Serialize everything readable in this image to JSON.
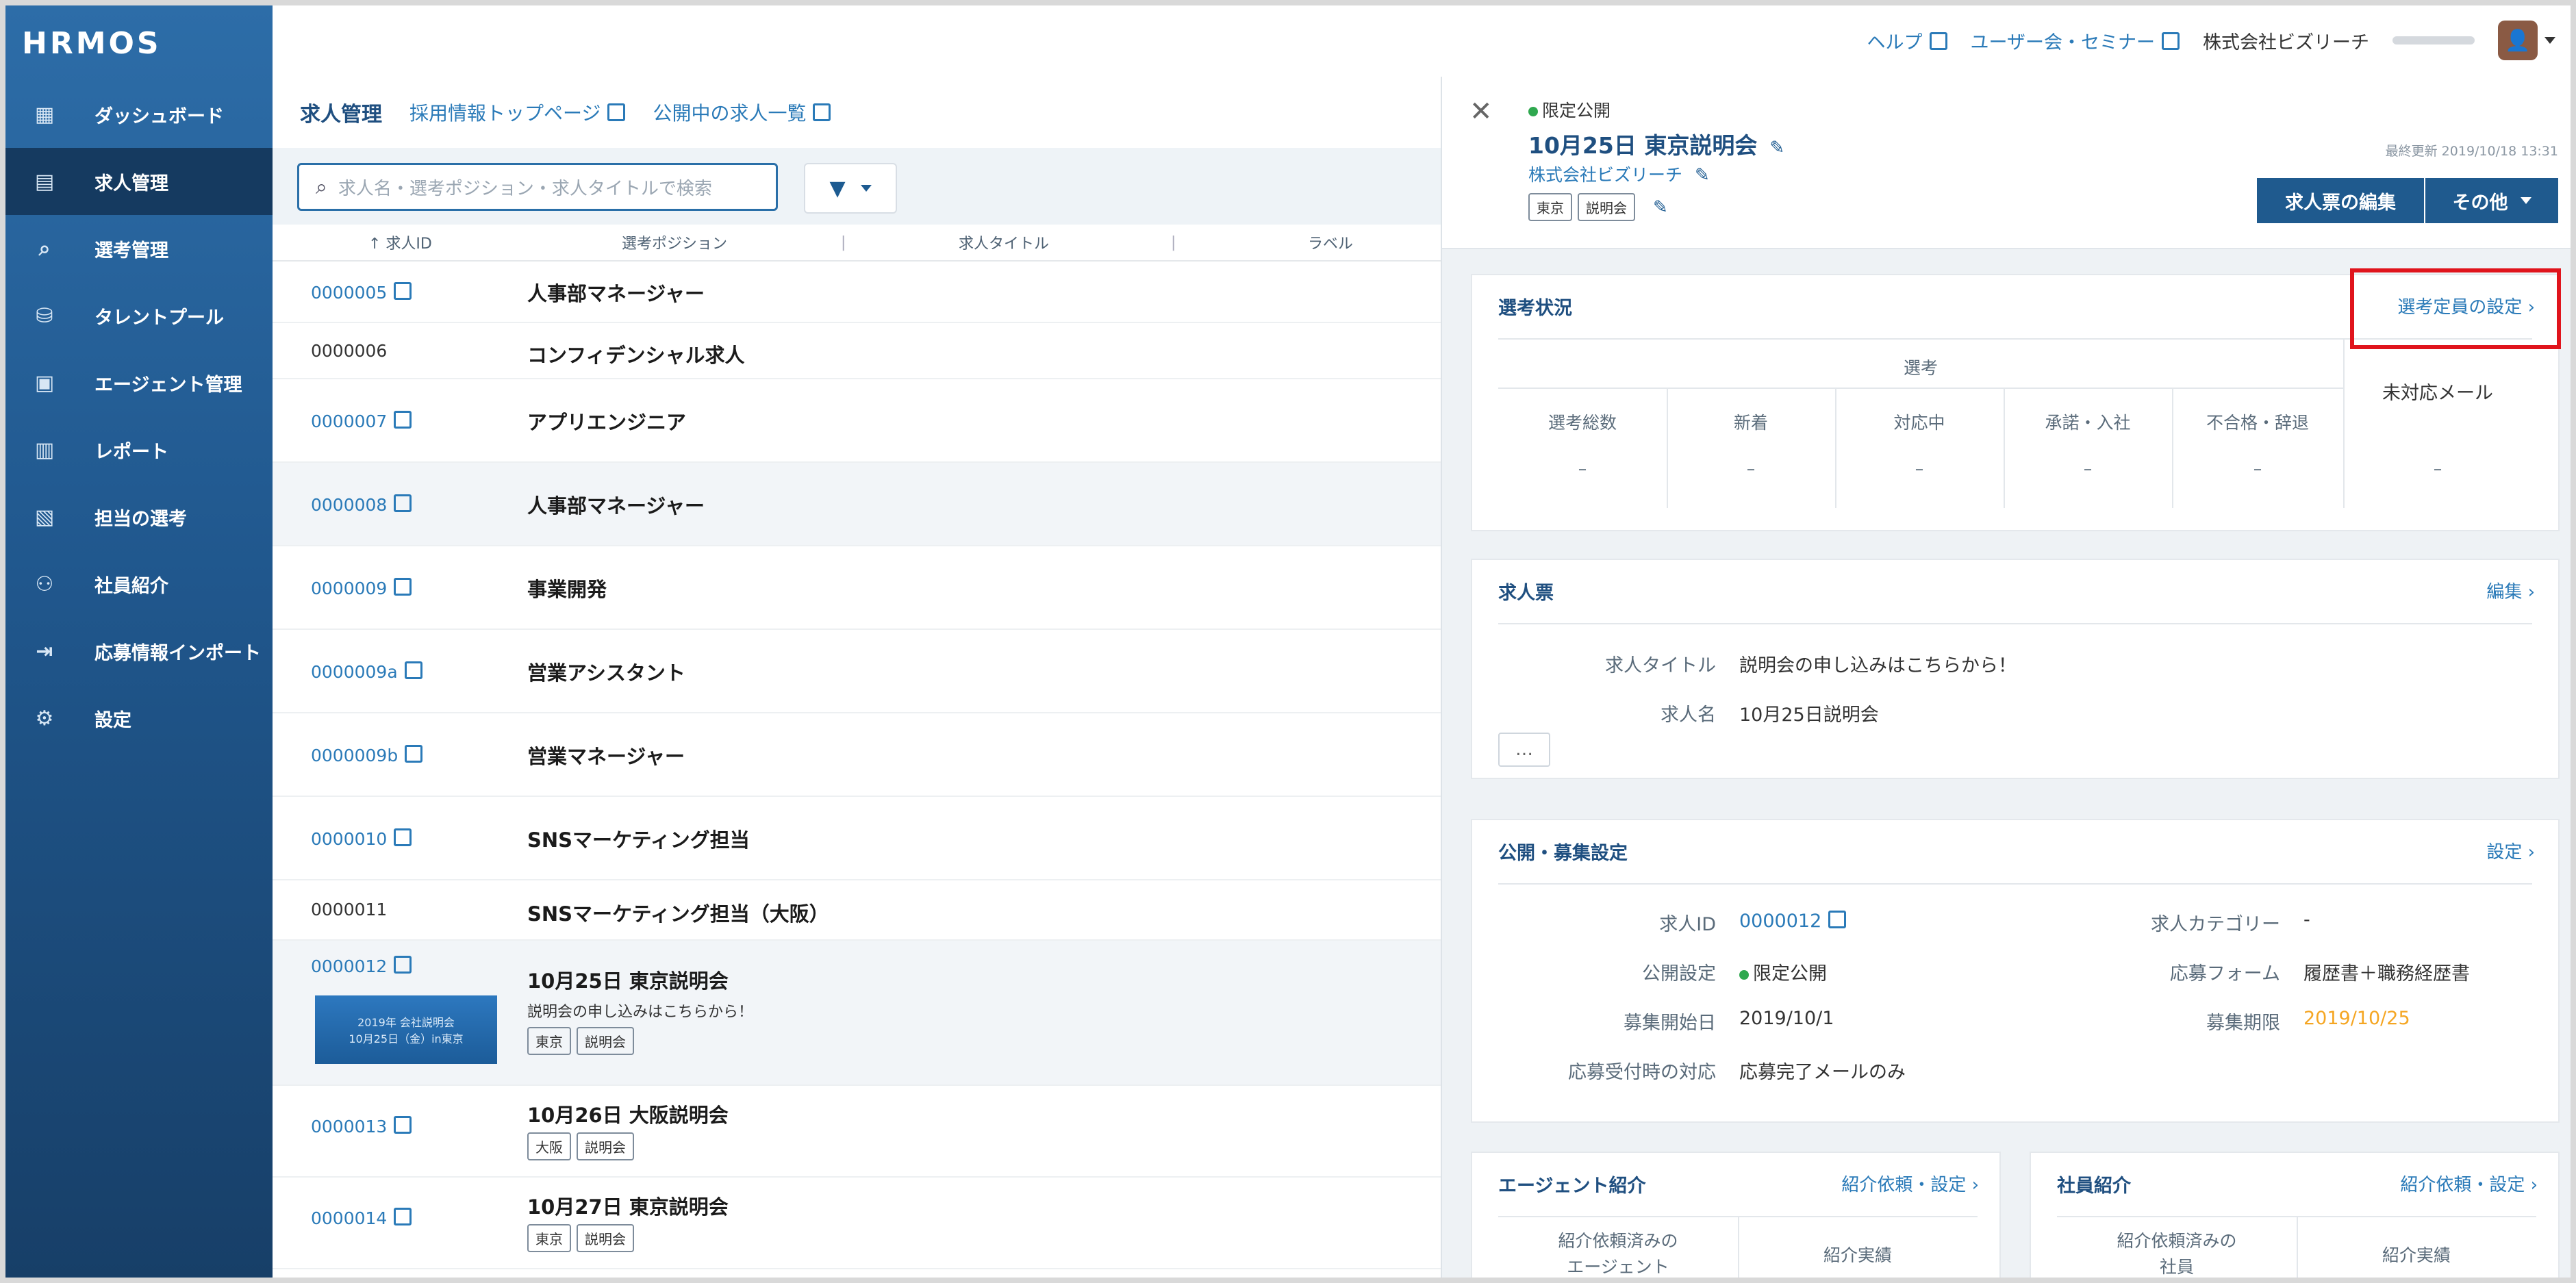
{
  "sidebar": {
    "logo": "HRMOS",
    "items": [
      {
        "label": "ダッシュボード",
        "icon": "dashboard-icon"
      },
      {
        "label": "求人管理",
        "icon": "job-icon",
        "active": true
      },
      {
        "label": "選考管理",
        "icon": "search-icon"
      },
      {
        "label": "タレントプール",
        "icon": "pool-icon"
      },
      {
        "label": "エージェント管理",
        "icon": "agent-icon"
      },
      {
        "label": "レポート",
        "icon": "report-icon"
      },
      {
        "label": "担当の選考",
        "icon": "assign-icon"
      },
      {
        "label": "社員紹介",
        "icon": "people-icon"
      },
      {
        "label": "応募情報インポート",
        "icon": "import-icon"
      },
      {
        "label": "設定",
        "icon": "gear-icon"
      }
    ]
  },
  "topbar": {
    "help": "ヘルプ",
    "seminar": "ユーザー会・セミナー",
    "company": "株式会社ビズリーチ"
  },
  "list": {
    "title": "求人管理",
    "link_top": "採用情報トップページ",
    "link_open": "公開中の求人一覧",
    "search_placeholder": "求人名・選考ポジション・求人タイトルで検索",
    "columns": {
      "id": "↑ 求人ID",
      "position": "選考ポジション",
      "title": "求人タイトル",
      "label": "ラベル"
    },
    "rows": [
      {
        "id": "0000005",
        "position": "人事部マネージャー",
        "link": true
      },
      {
        "id": "0000006",
        "position": "コンフィデンシャル求人",
        "link": false
      },
      {
        "id": "0000007",
        "position": "アプリエンジニア",
        "link": true
      },
      {
        "id": "0000008",
        "position": "人事部マネージャー",
        "link": true
      },
      {
        "id": "0000009",
        "position": "事業開発",
        "link": true
      },
      {
        "id": "0000009a",
        "position": "営業アシスタント",
        "link": true
      },
      {
        "id": "0000009b",
        "position": "営業マネージャー",
        "link": true
      },
      {
        "id": "0000010",
        "position": "SNSマーケティング担当",
        "link": true
      },
      {
        "id": "0000011",
        "position": "SNSマーケティング担当（大阪）",
        "link": false
      },
      {
        "id": "0000012",
        "position": "10月25日 東京説明会",
        "link": true,
        "subtitle": "説明会の申し込みはこちらから！",
        "tags": [
          "東京",
          "説明会"
        ],
        "thumb_line1": "2019年 会社説明会",
        "thumb_line2": "10月25日（金）in東京"
      },
      {
        "id": "0000013",
        "position": "10月26日 大阪説明会",
        "link": true,
        "tags": [
          "大阪",
          "説明会"
        ]
      },
      {
        "id": "0000014",
        "position": "10月27日 東京説明会",
        "link": true,
        "tags": [
          "東京",
          "説明会"
        ]
      }
    ]
  },
  "detail": {
    "status": "限定公開",
    "title": "10月25日 東京説明会",
    "company": "株式会社ビズリーチ",
    "tags": [
      "東京",
      "説明会"
    ],
    "updated": "最終更新 2019/10/18 13:31",
    "edit_button": "求人票の編集",
    "other_button": "その他",
    "selection": {
      "title": "選考状況",
      "link": "選考定員の設定",
      "group_header": "選考",
      "columns": [
        "選考総数",
        "新着",
        "対応中",
        "承諾・入社",
        "不合格・辞退"
      ],
      "unread": "未対応メール",
      "dash": "–"
    },
    "jobsheet": {
      "title": "求人票",
      "link": "編集",
      "fields": [
        {
          "label": "求人タイトル",
          "value": "説明会の申し込みはこちらから！"
        },
        {
          "label": "求人名",
          "value": "10月25日説明会"
        }
      ],
      "more": "…"
    },
    "publish": {
      "title": "公開・募集設定",
      "link": "設定",
      "left": [
        {
          "label": "求人ID",
          "value": "0000012"
        },
        {
          "label": "公開設定",
          "value": "限定公開"
        },
        {
          "label": "募集開始日",
          "value": "2019/10/1"
        },
        {
          "label": "応募受付時の対応",
          "value": "応募完了メールのみ"
        }
      ],
      "right": [
        {
          "label": "求人カテゴリー",
          "value": "-"
        },
        {
          "label": "応募フォーム",
          "value": "履歴書＋職務経歴書"
        },
        {
          "label": "募集期限",
          "value": "2019/10/25"
        }
      ]
    },
    "agent": {
      "title": "エージェント紹介",
      "link": "紹介依頼・設定",
      "col1a": "紹介依頼済みの",
      "col1b": "エージェント",
      "col2": "紹介実績"
    },
    "employee": {
      "title": "社員紹介",
      "link": "紹介依頼・設定",
      "col1a": "紹介依頼済みの",
      "col1b": "社員",
      "col2": "紹介実績"
    }
  },
  "colors": {
    "accent": "#2a7ab8",
    "sidebar": "#20578d",
    "highlight": "#e0141c",
    "deadline": "#f5a623",
    "public_dot": "#2fa84f"
  }
}
